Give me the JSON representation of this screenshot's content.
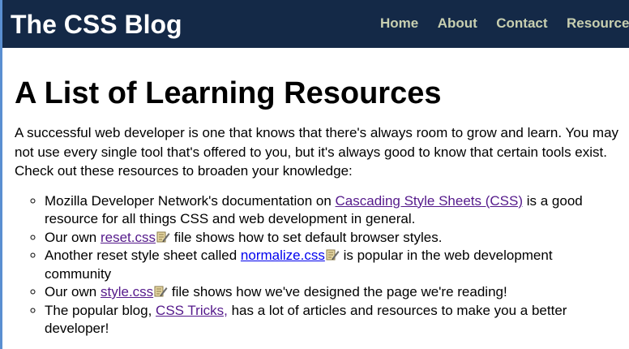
{
  "header": {
    "site_title": "The CSS Blog",
    "nav": [
      "Home",
      "About",
      "Contact",
      "Resources"
    ]
  },
  "main": {
    "title": "A List of Learning Resources",
    "intro": "A successful web developer is one that knows that there's always room to grow and learn. You may not use every single tool that's offered to you, but it's always good to know that certain tools exist. Check out these resources to broaden your knowledge:",
    "items": [
      {
        "before": "Mozilla Developer Network's documentation on ",
        "link": "Cascading Style Sheets (CSS)",
        "after": " is a good resource for all things CSS and web development in general."
      },
      {
        "before": "Our own ",
        "link": "reset.css",
        "after": " file shows how to set default browser styles."
      },
      {
        "before": "Another reset style sheet called ",
        "link": "normalize.css",
        "after": " is popular in the web development community"
      },
      {
        "before": "Our own ",
        "link": "style.css",
        "after": " file shows how we've designed the page we're reading!"
      },
      {
        "before": "The popular blog, ",
        "link": "CSS Tricks,",
        "after": " has a lot of articles and resources to make you a better developer!"
      }
    ]
  },
  "colors": {
    "header_bg": "#142947",
    "nav_text": "#c8cfb0",
    "visited_link": "#551a8b",
    "unvisited_link": "#0000ee"
  },
  "icons": {
    "file_icon": "file-edit-icon"
  }
}
